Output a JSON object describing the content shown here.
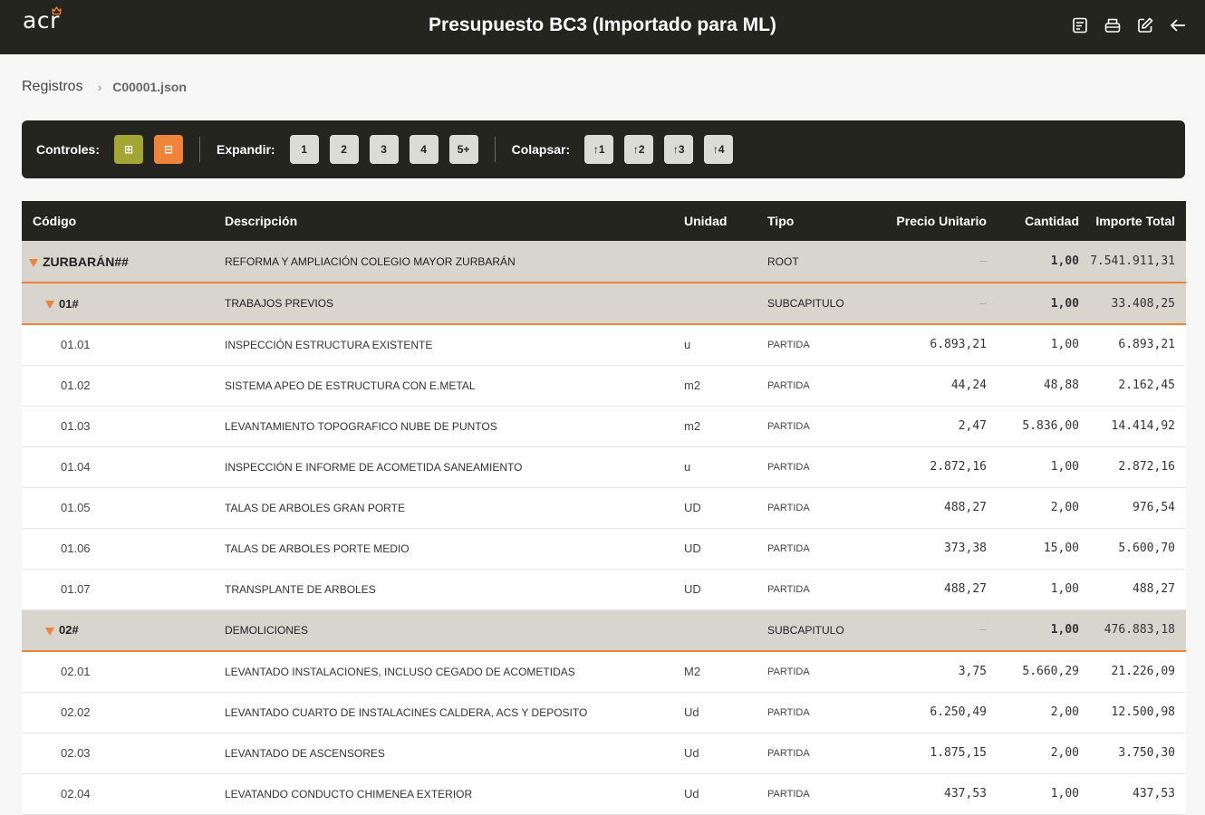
{
  "header": {
    "logo": "acr",
    "title": "Presupuesto BC3 (Importado para ML)",
    "icons": [
      "document-icon",
      "print-icon",
      "edit-icon",
      "back-arrow-icon"
    ]
  },
  "breadcrumb": {
    "root": "Registros",
    "current": "C00001.json"
  },
  "controls": {
    "label": "Controles:",
    "expand_all_icon": "⊞",
    "collapse_all_icon": "⊟",
    "expand_label": "Expandir:",
    "expand_levels": [
      "1",
      "2",
      "3",
      "4",
      "5+"
    ],
    "collapse_label": "Colapsar:",
    "collapse_levels": [
      "↑1",
      "↑2",
      "↑3",
      "↑4"
    ]
  },
  "table": {
    "columns": {
      "codigo": "Código",
      "descripcion": "Descripción",
      "unidad": "Unidad",
      "tipo": "Tipo",
      "precio": "Precio Unitario",
      "cantidad": "Cantidad",
      "importe": "Importe Total"
    },
    "rows": [
      {
        "code": "ZURBARÁN##",
        "desc": "REFORMA Y AMPLIACIÓN COLEGIO MAYOR ZURBARÁN",
        "unit": "",
        "tipo": "ROOT",
        "precio": "—",
        "cantidad": "1,00",
        "importe": "7.541.911,31"
      },
      {
        "code": "01#",
        "desc": "TRABAJOS PREVIOS",
        "unit": "",
        "tipo": "SUBCAPITULO",
        "precio": "—",
        "cantidad": "1,00",
        "importe": "33.408,25"
      },
      {
        "code": "01.01",
        "desc": "INSPECCIÓN ESTRUCTURA EXISTENTE",
        "unit": "u",
        "tipo": "PARTIDA",
        "precio": "6.893,21",
        "cantidad": "1,00",
        "importe": "6.893,21"
      },
      {
        "code": "01.02",
        "desc": "SISTEMA APEO DE ESTRUCTURA CON E.METAL",
        "unit": "m2",
        "tipo": "PARTIDA",
        "precio": "44,24",
        "cantidad": "48,88",
        "importe": "2.162,45"
      },
      {
        "code": "01.03",
        "desc": "LEVANTAMIENTO TOPOGRAFICO NUBE DE PUNTOS",
        "unit": "m2",
        "tipo": "PARTIDA",
        "precio": "2,47",
        "cantidad": "5.836,00",
        "importe": "14.414,92"
      },
      {
        "code": "01.04",
        "desc": "INSPECCIÓN E INFORME DE ACOMETIDA SANEAMIENTO",
        "unit": "u",
        "tipo": "PARTIDA",
        "precio": "2.872,16",
        "cantidad": "1,00",
        "importe": "2.872,16"
      },
      {
        "code": "01.05",
        "desc": "TALAS DE ARBOLES GRAN PORTE",
        "unit": "UD",
        "tipo": "PARTIDA",
        "precio": "488,27",
        "cantidad": "2,00",
        "importe": "976,54"
      },
      {
        "code": "01.06",
        "desc": "TALAS DE ARBOLES PORTE MEDIO",
        "unit": "UD",
        "tipo": "PARTIDA",
        "precio": "373,38",
        "cantidad": "15,00",
        "importe": "5.600,70"
      },
      {
        "code": "01.07",
        "desc": "TRANSPLANTE DE ARBOLES",
        "unit": "UD",
        "tipo": "PARTIDA",
        "precio": "488,27",
        "cantidad": "1,00",
        "importe": "488,27"
      },
      {
        "code": "02#",
        "desc": "DEMOLICIONES",
        "unit": "",
        "tipo": "SUBCAPITULO",
        "precio": "—",
        "cantidad": "1,00",
        "importe": "476.883,18"
      },
      {
        "code": "02.01",
        "desc": "LEVANTADO INSTALACIONES, INCLUSO CEGADO DE ACOMETIDAS",
        "unit": "M2",
        "tipo": "PARTIDA",
        "precio": "3,75",
        "cantidad": "5.660,29",
        "importe": "21.226,09"
      },
      {
        "code": "02.02",
        "desc": "LEVANTADO CUARTO DE INSTALACINES CALDERA, ACS Y DEPOSITO",
        "unit": "Ud",
        "tipo": "PARTIDA",
        "precio": "6.250,49",
        "cantidad": "2,00",
        "importe": "12.500,98"
      },
      {
        "code": "02.03",
        "desc": "LEVANTADO DE ASCENSORES",
        "unit": "Ud",
        "tipo": "PARTIDA",
        "precio": "1.875,15",
        "cantidad": "2,00",
        "importe": "3.750,30"
      },
      {
        "code": "02.04",
        "desc": "LEVATANDO CONDUCTO CHIMENEA EXTERIOR",
        "unit": "Ud",
        "tipo": "PARTIDA",
        "precio": "437,53",
        "cantidad": "1,00",
        "importe": "437,53"
      }
    ]
  },
  "colors": {
    "header_bg": "#252520",
    "accent_orange": "#ee8339",
    "accent_olive": "#a3a632",
    "group_row_bg": "#d8d5cf"
  }
}
